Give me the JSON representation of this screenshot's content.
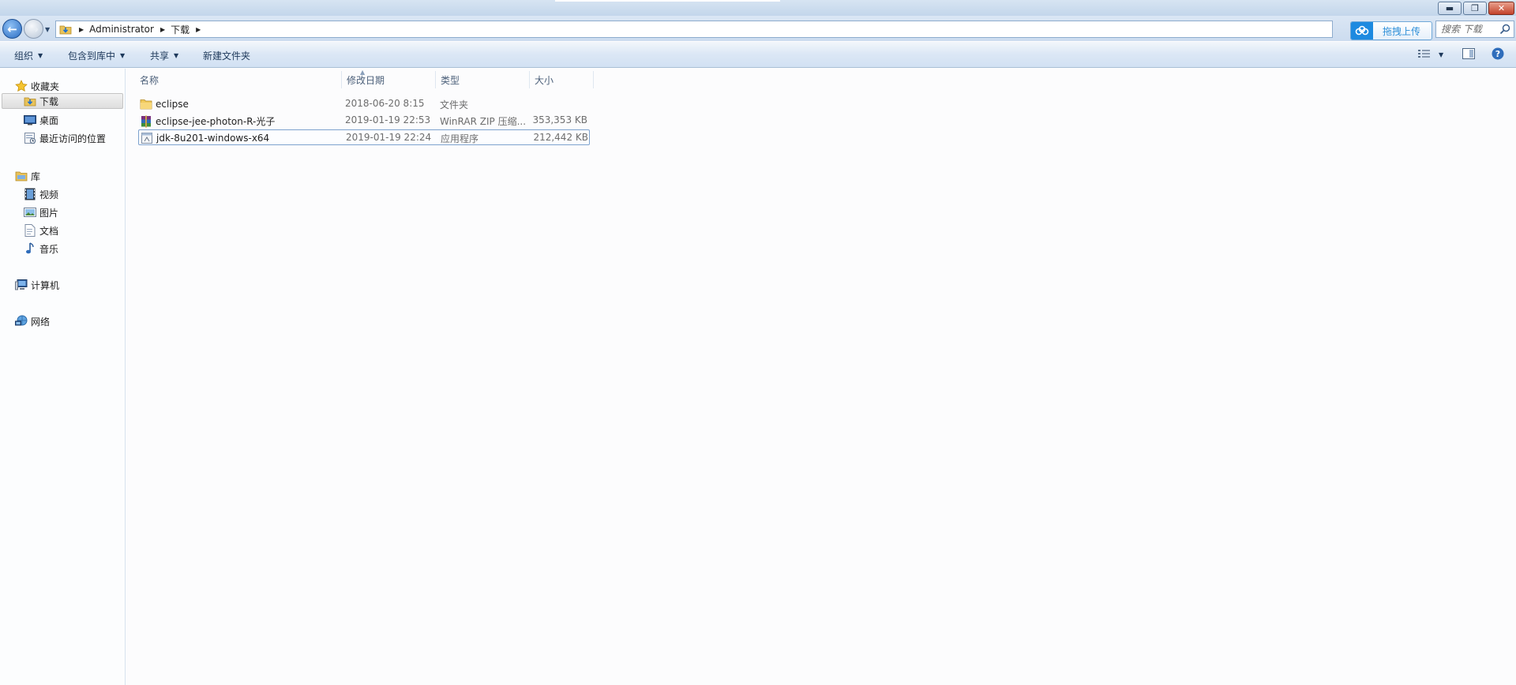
{
  "window": {
    "minimize_glyph": "▬",
    "maximize_glyph": "❐",
    "close_glyph": "✕"
  },
  "address": {
    "crumbs": [
      "Administrator",
      "下载"
    ],
    "separator_glyph": "▶"
  },
  "upload": {
    "label": "拖拽上传",
    "icon": "cloud-icon"
  },
  "search": {
    "placeholder": "搜索 下载"
  },
  "commands": {
    "organize": "组织",
    "include_library": "包含到库中",
    "share": "共享",
    "new_folder": "新建文件夹"
  },
  "nav": {
    "favorites": {
      "label": "收藏夹",
      "items": [
        "下载",
        "桌面",
        "最近访问的位置"
      ]
    },
    "libraries": {
      "label": "库",
      "items": [
        "视频",
        "图片",
        "文档",
        "音乐"
      ]
    },
    "computer": "计算机",
    "network": "网络"
  },
  "columns": {
    "name": "名称",
    "date": "修改日期",
    "type": "类型",
    "size": "大小"
  },
  "files": [
    {
      "name": "eclipse",
      "date": "2018-06-20 8:15",
      "type": "文件夹",
      "size": "",
      "icon": "folder-icon"
    },
    {
      "name": "eclipse-jee-photon-R-光子",
      "date": "2019-01-19 22:53",
      "type": "WinRAR ZIP 压缩...",
      "size": "353,353 KB",
      "icon": "winrar-icon"
    },
    {
      "name": "jdk-8u201-windows-x64",
      "date": "2019-01-19 22:24",
      "type": "应用程序",
      "size": "212,442 KB",
      "icon": "exe-icon"
    }
  ],
  "colors": {
    "accent": "#2e8fd8",
    "titlebar": "#c3d6eb",
    "close_button": "#c3432b",
    "focus_border": "#7da2ce"
  }
}
